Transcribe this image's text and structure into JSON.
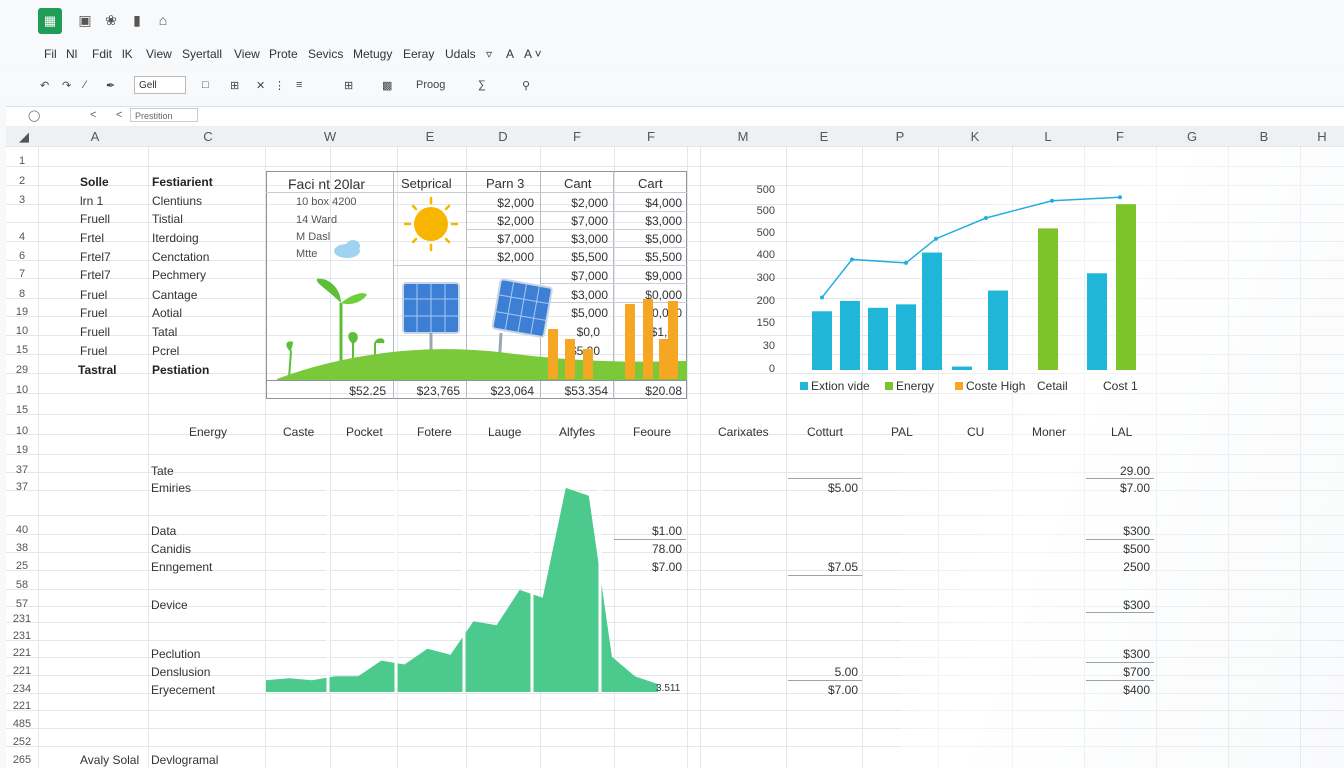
{
  "menu": [
    "Fil",
    "Nl",
    "Fdit",
    "lK",
    "View",
    "Syertall",
    "View",
    "Prote",
    "Sevics",
    "Metugy",
    "Eeray",
    "Udals"
  ],
  "toolbar": {
    "font_size": "Gell",
    "zoom": "Proog"
  },
  "formula_bar": {
    "cell_ref": "Prestition"
  },
  "column_headers": [
    "A",
    "C",
    "W",
    "E",
    "D",
    "F",
    "F",
    "M",
    "E",
    "P",
    "K",
    "L",
    "F",
    "G",
    "B",
    "H"
  ],
  "rows": {
    "r1": "1",
    "r2": "2",
    "r3": "3",
    "r4": "4",
    "r6": "6",
    "r7": "7",
    "r8": "8",
    "r19": "19",
    "r10": "10",
    "r15": "15",
    "r29": "29",
    "r10b": "10",
    "r15b": "15",
    "r10c": "10",
    "r19b": "19",
    "r37": "37",
    "r37b": "37",
    "r40": "40",
    "r38": "38",
    "r25": "25",
    "r58": "58",
    "r57": "57",
    "r231": "231",
    "r231b": "231",
    "r221": "221",
    "r221b": "221",
    "r234": "234",
    "r221c": "221",
    "r485": "485",
    "r252": "252",
    "r265": "265"
  },
  "col_a": [
    "Solle",
    "lrn 1",
    "Fruell",
    "Frtel",
    "Frtel7",
    "Frtel7",
    "Fruel",
    "Fruel",
    "Fruell",
    "Fruel",
    "Tastral"
  ],
  "col_c": [
    "Festiarient",
    "Clentiuns",
    "Tistial",
    "Iterdoing",
    "Cenctation",
    "Pechmery",
    "Cantage",
    "Aotial",
    "Tatal",
    "Pcrel",
    "Pestiation"
  ],
  "box_headers": [
    "Faci nt 20lar",
    "Setprical",
    "Parn 3",
    "Cant",
    "Cart"
  ],
  "box_text": [
    "10 box 4200",
    "14 Ward",
    "M Dasl",
    "Mtte"
  ],
  "box_col_e": [
    "$2,000",
    "$2,000",
    "$7,000",
    "$2,000"
  ],
  "box_col_f": [
    "$2,000",
    "$7,000",
    "$3,000",
    "$5,500",
    "$7,000",
    "$3,000",
    "$5,000",
    "$0,0",
    "$5,00"
  ],
  "box_col_g": [
    "$4,000",
    "$3,000",
    "$5,000",
    "$5,500",
    "$9,000",
    "$0,000",
    "$0,000",
    "$1,0"
  ],
  "box_totals": [
    "$52.25",
    "$23,765",
    "$23,064",
    "$53.354",
    "$20.08"
  ],
  "section2_headers": [
    "Energy",
    "Caste",
    "Pocket",
    "Fotere",
    "Lauge",
    "Alfyfes",
    "Feoure",
    "Carixates",
    "Cotturt",
    "PAL",
    "CU",
    "Moner",
    "LAL"
  ],
  "lower_labels": [
    "Tate",
    "Emiries",
    "Data",
    "Canidis",
    "Enngement",
    "Device",
    "Peclution",
    "Denslusion",
    "Eryecement"
  ],
  "lower_values_f": [
    "$1.00",
    "78.00",
    "$7.00"
  ],
  "lower_values_e": [
    "$5.00",
    "$7.05",
    "5.00",
    "$7.00"
  ],
  "lower_values_l": [
    "29.00",
    "$7.00",
    "$300",
    "$500",
    "2500",
    "$300",
    "$300",
    "$700",
    "$400"
  ],
  "lower_area_label": "3.511",
  "footer": {
    "a": "Avaly Solal",
    "c": "Devlogramal"
  },
  "bar_chart": {
    "y_ticks": [
      "500",
      "500",
      "500",
      "400",
      "300",
      "200",
      "150",
      "30",
      "0"
    ],
    "legend": [
      "Extion vide",
      "Energy",
      "Coste High",
      "Cetail",
      "Cost 1"
    ]
  },
  "chart_data": [
    {
      "type": "bar",
      "title": "",
      "series": [
        {
          "name": "Extion vide",
          "values": [
            170,
            200,
            180,
            190,
            340,
            10,
            230
          ]
        },
        {
          "name": "Energy",
          "values": [
            410,
            480
          ]
        },
        {
          "name": "Coste High",
          "values": [
            0
          ]
        }
      ],
      "line": [
        210,
        320,
        310,
        380,
        440,
        490,
        500
      ],
      "ylim": [
        0,
        550
      ],
      "colors": {
        "cyan": "#1fb6da",
        "green": "#7dc42a",
        "orange": "#f5a623",
        "line": "#22aee0"
      }
    },
    {
      "type": "area",
      "title": "",
      "values": [
        30,
        35,
        30,
        40,
        40,
        80,
        70,
        110,
        95,
        180,
        170,
        260,
        240,
        520,
        500,
        90,
        40,
        20
      ],
      "color": "#4cc98d"
    }
  ]
}
